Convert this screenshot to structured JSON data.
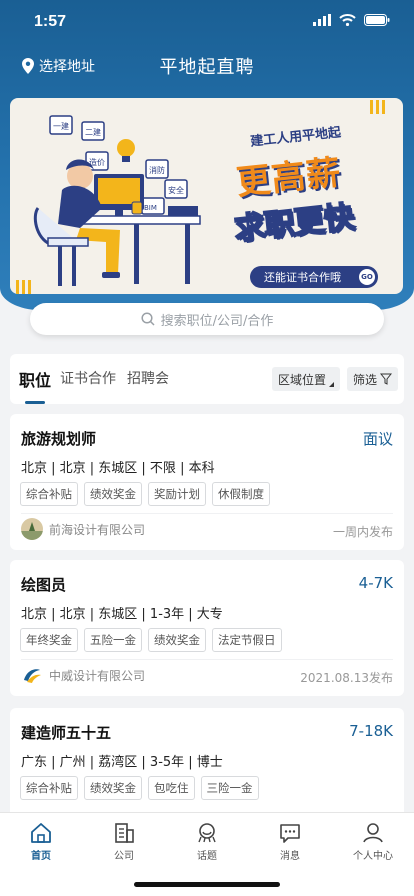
{
  "status_bar": {
    "time": "1:57"
  },
  "header": {
    "location_label": "选择地址",
    "title": "平地起直聘"
  },
  "banner": {
    "line1": "建工人用平地起",
    "main": "更高薪",
    "sub": "求职更快",
    "pill": "还能证书合作哦",
    "go": "GO",
    "board_labels": [
      "一建",
      "二建",
      "造价",
      "消防",
      "安全",
      "BIM"
    ]
  },
  "search": {
    "placeholder": "搜索职位/公司/合作"
  },
  "tabs": {
    "items": [
      {
        "label": "职位",
        "active": true
      },
      {
        "label": "证书合作",
        "active": false
      },
      {
        "label": "招聘会",
        "active": false
      }
    ],
    "filters": {
      "region": "区域位置",
      "filter": "筛选"
    }
  },
  "jobs": [
    {
      "title": "旅游规划师",
      "salary": "面议",
      "meta": "北京 | 北京 | 东城区 | 不限 | 本科",
      "tags": [
        "综合补贴",
        "绩效奖金",
        "奖励计划",
        "休假制度"
      ],
      "company": "前海设计有限公司",
      "posted": "一周内发布"
    },
    {
      "title": "绘图员",
      "salary": "4-7K",
      "meta": "北京 | 北京 | 东城区 | 1-3年 | 大专",
      "tags": [
        "年终奖金",
        "五险一金",
        "绩效奖金",
        "法定节假日"
      ],
      "company": "中威设计有限公司",
      "posted": "2021.08.13发布"
    },
    {
      "title": "建造师五十五",
      "salary": "7-18K",
      "meta": "广东 | 广州 | 荔湾区 | 3-5年 | 博士",
      "tags": [
        "综合补贴",
        "绩效奖金",
        "包吃住",
        "三险一金"
      ],
      "company": "",
      "posted": ""
    }
  ],
  "tabbar": {
    "items": [
      {
        "label": "首页",
        "icon": "home-icon",
        "active": true
      },
      {
        "label": "公司",
        "icon": "building-icon",
        "active": false
      },
      {
        "label": "话题",
        "icon": "topic-icon",
        "active": false
      },
      {
        "label": "消息",
        "icon": "message-icon",
        "active": false
      },
      {
        "label": "个人中心",
        "icon": "profile-icon",
        "active": false
      }
    ]
  },
  "colors": {
    "brand": "#1a5f94",
    "accent": "#f08a1a",
    "banner_navy": "#2c3f84"
  }
}
